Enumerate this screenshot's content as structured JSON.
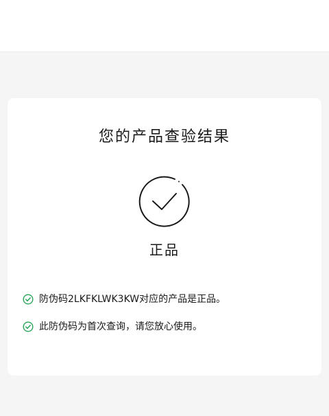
{
  "card": {
    "title": "您的产品查验结果",
    "result": "正品"
  },
  "messages": [
    "防伪码2LKFKLWK3KW对应的产品是正品。",
    "此防伪码为首次查询，请您放心使用。"
  ],
  "icons": {
    "result": "check-circle-icon",
    "message": "check-circle-small-icon"
  },
  "colors": {
    "accent_green": "#2aa55a",
    "outline": "#1a1a1a"
  }
}
